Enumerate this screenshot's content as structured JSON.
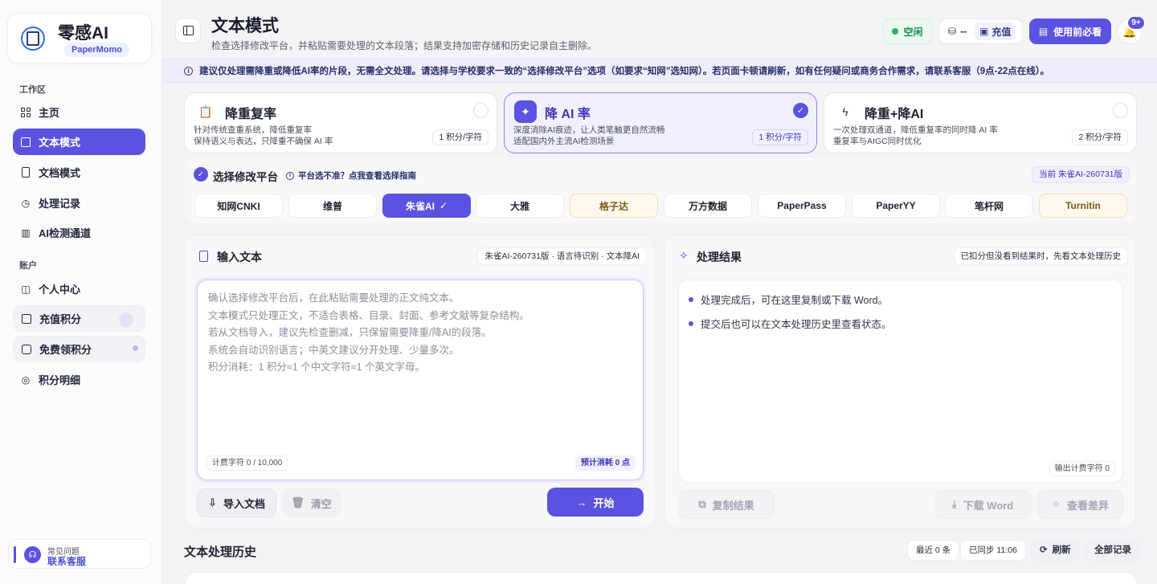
{
  "brand": {
    "name": "零感AI",
    "sub": "PaperMomo"
  },
  "sidebar": {
    "section_workspace": "工作区",
    "section_account": "账户",
    "items": [
      {
        "label": "主页",
        "icon": "home-grid-icon"
      },
      {
        "label": "文本模式",
        "icon": "text-doc-icon",
        "active": true
      },
      {
        "label": "文档模式",
        "icon": "file-icon"
      },
      {
        "label": "处理记录",
        "icon": "history-icon"
      },
      {
        "label": "AI检测通道",
        "icon": "chart-icon"
      },
      {
        "label": "个人中心",
        "icon": "user-icon"
      },
      {
        "label": "充值积分",
        "icon": "wallet-icon"
      },
      {
        "label": "免费领积分",
        "icon": "gift-icon"
      },
      {
        "label": "积分明细",
        "icon": "coins-icon"
      }
    ],
    "support": {
      "line1": "常见问题",
      "line2": "联系客服"
    }
  },
  "header": {
    "title": "文本模式",
    "subtitle": "检查选择修改平台，并粘贴需要处理的文本段落；结果支持加密存储和历史记录自主删除。",
    "status": "空闲",
    "credits_value": "--",
    "recharge_label": "充值",
    "must_read_label": "使用前必看",
    "notification_badge": "9+"
  },
  "notice": "建议仅处理需降重或降低AI率的片段，无需全文处理。请选择与学校要求一致的“选择修改平台”选项（如要求“知网”选知网）。若页面卡顿请刷新，如有任何疑问或商务合作需求，请联系客服（9点-22点在线）。",
  "modes": [
    {
      "title": "降重复率",
      "desc1": "针对传统查重系统，降低重复率",
      "desc2": "保持语义与表达，只降重不确保 AI 率",
      "price": "1 积分/字符",
      "selected": false
    },
    {
      "title": "降 AI 率",
      "desc1": "深度消除AI痕迹，让人类笔触更自然流畅",
      "desc2": "适配国内外主流AI检测场景",
      "price": "1 积分/字符",
      "selected": true
    },
    {
      "title": "降重+降AI",
      "desc1": "一次处理双通道，降低重复率的同时降 AI 率",
      "desc2": "重复率与AIGC同时优化",
      "price": "2 积分/字符",
      "selected": false
    }
  ],
  "platform": {
    "title": "选择修改平台",
    "help": "平台选不准？点我查看选择指南",
    "current": "当前 朱雀AI-260731版",
    "options": [
      {
        "label": "知网CNKI",
        "state": "normal"
      },
      {
        "label": "维普",
        "state": "normal"
      },
      {
        "label": "朱雀AI",
        "state": "selected"
      },
      {
        "label": "大雅",
        "state": "normal"
      },
      {
        "label": "格子达",
        "state": "warn"
      },
      {
        "label": "万方数据",
        "state": "normal"
      },
      {
        "label": "PaperPass",
        "state": "normal"
      },
      {
        "label": "PaperYY",
        "state": "normal"
      },
      {
        "label": "笔杆网",
        "state": "normal"
      },
      {
        "label": "Turnitin",
        "state": "warn"
      }
    ]
  },
  "input": {
    "title": "输入文本",
    "tag": "朱雀AI-260731版 · 语言待识别 · 文本降AI",
    "placeholder_lines": [
      "确认选择修改平台后，在此粘贴需要处理的正文纯文本。",
      "文本模式只处理正文，不适合表格、目录、封面、参考文献等复杂结构。",
      "若从文档导入，建议先检查删减，只保留需要降重/降AI的段落。",
      "系统会自动识别语言；中英文建议分开处理、少量多次。",
      "积分消耗：1 积分≈1 个中文字符≈1 个英文字母。"
    ],
    "char_count": "计费字符 0 / 10,000",
    "est_cost": "预计消耗 0 点",
    "import_label": "导入文档",
    "clear_label": "清空",
    "start_label": "开始"
  },
  "result": {
    "title": "处理结果",
    "tag": "已扣分但没看到结果时，先看文本处理历史",
    "items": [
      "处理完成后，可在这里复制或下载 Word。",
      "提交后也可以在文本处理历史里查看状态。"
    ],
    "out_count": "输出计费字符 0",
    "copy_label": "复制结果",
    "download_label": "下载 Word",
    "diff_label": "查看差异"
  },
  "history": {
    "title": "文本处理历史",
    "recent": "最近 0 条",
    "synced": "已同步 11:06",
    "refresh_label": "刷新",
    "all_label": "全部记录"
  },
  "colors": {
    "accent": "#5a52e0",
    "status_green": "#1fb85e",
    "notice_bg": "#eeeefa"
  }
}
